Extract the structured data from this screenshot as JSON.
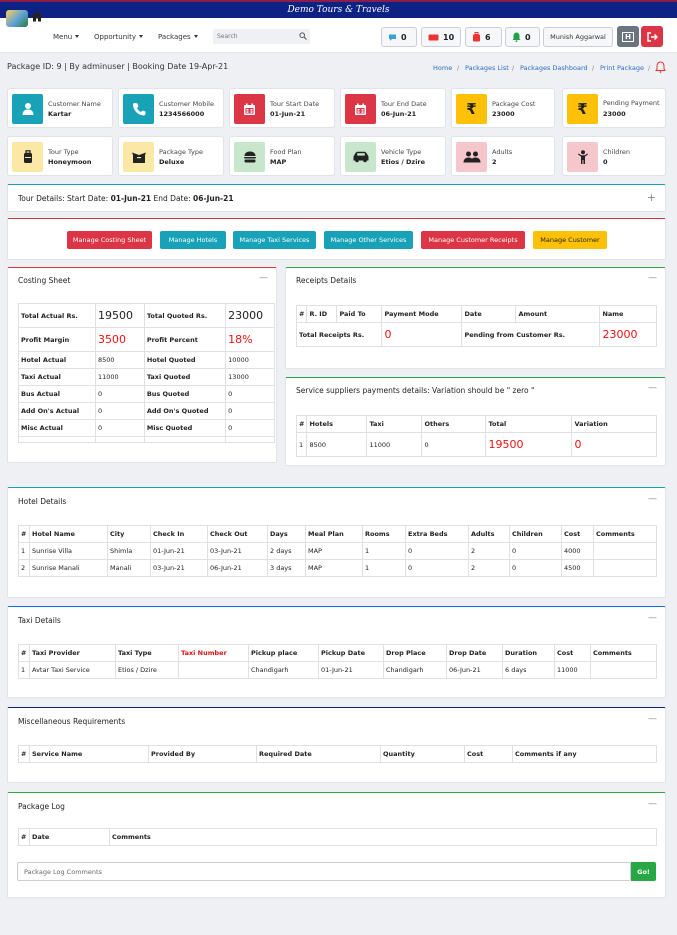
{
  "app": {
    "title": "Demo Tours & Travels"
  },
  "nav": {
    "menu_label": "Menu",
    "opportunity_label": "Opportunity",
    "packages_label": "Packages",
    "search_placeholder": "Search",
    "btn_messages": "0",
    "btn_tickets": "10",
    "btn_bookings": "6",
    "btn_alerts": "0",
    "user_name": "Munish Aggarwal",
    "h_label": "H"
  },
  "header": {
    "package_line": "Package ID: 9 | By adminuser | Booking Date 19-Apr-21",
    "breadcrumbs": [
      "Home",
      "Packages List",
      "Packages Dashboard",
      "Print Package"
    ]
  },
  "cards": [
    {
      "label": "Customer Name",
      "value": "Kartar",
      "icon": "user-icon"
    },
    {
      "label": "Customer Mobile",
      "value": "1234566000",
      "icon": "phone-icon"
    },
    {
      "label": "Tour Start Date",
      "value": "01-Jun-21",
      "icon": "calendar-icon"
    },
    {
      "label": "Tour End Date",
      "value": "06-Jun-21",
      "icon": "calendar-icon"
    },
    {
      "label": "Package Cost",
      "value": "23000",
      "icon": "rupee-icon"
    },
    {
      "label": "Pending Payment",
      "value": "23000",
      "icon": "rupee-icon"
    },
    {
      "label": "Tour Type",
      "value": "Honeymoon",
      "icon": "suitcase-icon"
    },
    {
      "label": "Package Type",
      "value": "Deluxe",
      "icon": "box-icon"
    },
    {
      "label": "Food Plan",
      "value": "MAP",
      "icon": "burger-icon"
    },
    {
      "label": "Vehicle Type",
      "value": "Etios / Dzire",
      "icon": "car-icon"
    },
    {
      "label": "Adults",
      "value": "2",
      "icon": "users-icon"
    },
    {
      "label": "Children",
      "value": "0",
      "icon": "child-icon"
    }
  ],
  "tour_details": {
    "prefix": "Tour Details: Start Date: ",
    "start": "01-Jun-21",
    "mid": " End Date: ",
    "end": "06-Jun-21",
    "plus": "+"
  },
  "actions": [
    "Manage Costing Sheet",
    "Manage Hotels",
    "Manage Taxi Services",
    "Manage Other Services",
    "Manage Customer Receipts",
    "Manage Customer"
  ],
  "costing": {
    "title": "Costing Sheet",
    "rows": [
      [
        "Total Actual Rs.",
        "19500",
        "Total Quoted Rs.",
        "23000"
      ],
      [
        "Profit Margin",
        "3500",
        "Profit Percent",
        "18%"
      ],
      [
        "Hotel Actual",
        "8500",
        "Hotel Quoted",
        "10000"
      ],
      [
        "Taxi Actual",
        "11000",
        "Taxi Quoted",
        "13000"
      ],
      [
        "Bus Actual",
        "0",
        "Bus Quoted",
        "0"
      ],
      [
        "Add On's Actual",
        "0",
        "Add On's Quoted",
        "0"
      ],
      [
        "Misc Actual",
        "0",
        "Misc Quoted",
        "0"
      ]
    ]
  },
  "receipts": {
    "title": "Receipts Details",
    "headers": [
      "#",
      "R. ID",
      "Paid To",
      "Payment Mode",
      "Date",
      "Amount",
      "Name"
    ],
    "total_label": "Total Receipts Rs.",
    "total_value": "0",
    "pending_label": "Pending from Customer Rs.",
    "pending_value": "23000"
  },
  "suppliers": {
    "title": "Service suppliers payments details: Variation should be \" zero \"",
    "headers": [
      "#",
      "Hotels",
      "Taxi",
      "Others",
      "Total",
      "Variation"
    ],
    "row": [
      "1",
      "8500",
      "11000",
      "0",
      "19500",
      "0"
    ]
  },
  "hotels": {
    "title": "Hotel Details",
    "headers": [
      "#",
      "Hotel Name",
      "City",
      "Check In",
      "Check Out",
      "Days",
      "Meal Plan",
      "Rooms",
      "Extra Beds",
      "Adults",
      "Children",
      "Cost",
      "Comments"
    ],
    "rows": [
      [
        "1",
        "Sunrise Villa",
        "Shimla",
        "01-Jun-21",
        "03-Jun-21",
        "2 days",
        "MAP",
        "1",
        "0",
        "2",
        "0",
        "4000",
        ""
      ],
      [
        "2",
        "Sunrise Manali",
        "Manali",
        "03-Jun-21",
        "06-Jun-21",
        "3 days",
        "MAP",
        "1",
        "0",
        "2",
        "0",
        "4500",
        ""
      ]
    ]
  },
  "taxi": {
    "title": "Taxi Details",
    "headers": [
      "#",
      "Taxi Provider",
      "Taxi Type",
      "Taxi Number",
      "Pickup place",
      "Pickup Date",
      "Drop Place",
      "Drop Date",
      "Duration",
      "Cost",
      "Comments"
    ],
    "rows": [
      [
        "1",
        "Avtar Taxi Service",
        "Etios / Dzire",
        "",
        "Chandigarh",
        "01-Jun-21",
        "Chandigarh",
        "06-Jun-21",
        "6 days",
        "11000",
        ""
      ]
    ]
  },
  "misc": {
    "title": "Miscellaneous Requirements",
    "headers": [
      "#",
      "Service Name",
      "Provided By",
      "Required Date",
      "Quantity",
      "Cost",
      "Comments if any"
    ]
  },
  "log": {
    "title": "Package Log",
    "headers": [
      "#",
      "Date",
      "Comments"
    ],
    "placeholder": "Package Log Comments",
    "go_label": "Go!"
  },
  "colors": {
    "navy": "#0d2283",
    "teal": "#17a2b8",
    "red": "#dc3545",
    "yellow": "#ffc107",
    "green": "#28a745"
  }
}
